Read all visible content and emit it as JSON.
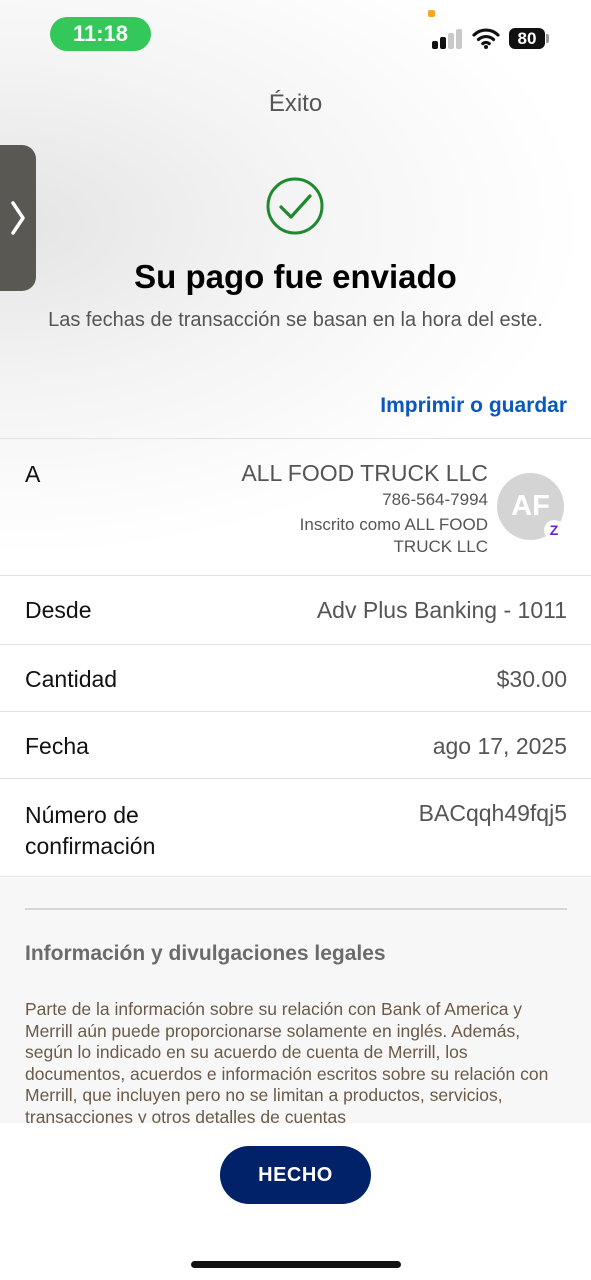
{
  "status_bar": {
    "time": "11:18",
    "battery": "80"
  },
  "header": {
    "title": "Éxito"
  },
  "success": {
    "headline": "Su pago fue enviado",
    "subtext": "Las fechas de transacción se basan en la hora del este."
  },
  "actions": {
    "print_label": "Imprimir o guardar",
    "done_label": "HECHO"
  },
  "details": {
    "to": {
      "label": "A",
      "name": "ALL FOOD TRUCK LLC",
      "phone": "786-564-7994",
      "enrolled": "Inscrito como ALL FOOD TRUCK LLC",
      "initials": "AF",
      "badge": "Z"
    },
    "from": {
      "label": "Desde",
      "value": "Adv Plus Banking - 1011"
    },
    "amount": {
      "label": "Cantidad",
      "value": "$30.00"
    },
    "date": {
      "label": "Fecha",
      "value": "ago 17, 2025"
    },
    "confirmation": {
      "label": "Número de confirmación",
      "value": "BACqqh49fqj5"
    }
  },
  "legal": {
    "title": "Información y divulgaciones legales",
    "body": "Parte de la información sobre su relación con Bank of America y Merrill aún puede proporcionarse solamente en inglés. Además, según lo indicado en su acuerdo de cuenta de Merrill, los documentos, acuerdos e información escritos sobre su relación con Merrill, que incluyen pero no se limitan a productos, servicios, transacciones y otros detalles de cuentas"
  },
  "colors": {
    "success_green": "#1e8a2e",
    "link_blue": "#0a58bf",
    "button_navy": "#012169",
    "time_pill_green": "#34c759",
    "zelle_purple": "#6d1ed4"
  },
  "icons": {
    "check": "check-circle-icon",
    "side_handle": "chevron-right-icon",
    "signal": "cellular-signal-icon",
    "wifi": "wifi-icon",
    "battery": "battery-icon"
  }
}
